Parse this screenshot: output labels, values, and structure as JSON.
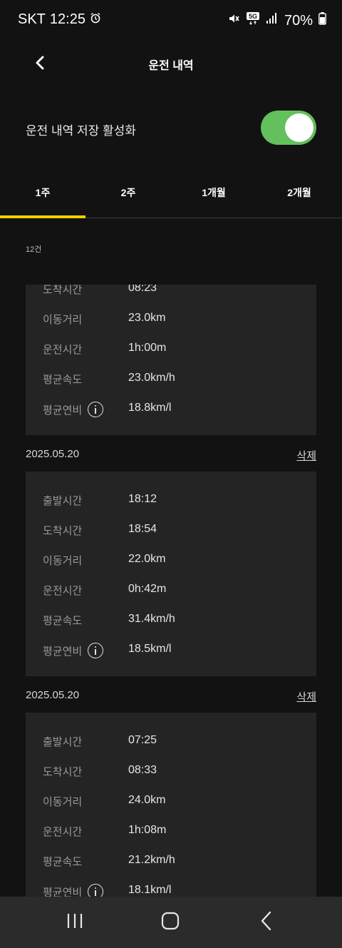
{
  "status_bar": {
    "carrier": "SKT",
    "time": "12:25",
    "battery": "70%",
    "network": "5G",
    "icons": [
      "alarm-icon",
      "mute-icon",
      "5g-icon",
      "signal-icon",
      "battery-icon"
    ]
  },
  "header": {
    "title": "운전 내역",
    "back_icon": "chevron-left-icon"
  },
  "settings": {
    "save_history_label": "운전 내역 저장 활성화",
    "save_history_enabled": true,
    "toggle_color": "#63c05c"
  },
  "tabs": {
    "items": [
      "1주",
      "2주",
      "1개월",
      "2개월"
    ],
    "selected": "1주",
    "indicator_color": "#f3d000"
  },
  "list": {
    "count_label": "12건",
    "labels": {
      "departure": "출발시간",
      "arrival": "도착시간",
      "distance": "이동거리",
      "driving_time": "운전시간",
      "avg_speed": "평균속도",
      "avg_fuel": "평균연비"
    },
    "delete_label": "삭제",
    "records": [
      {
        "date": "",
        "arrival": "08:23",
        "distance": "23.0km",
        "driving_time": "1h:00m",
        "avg_speed": "23.0km/h",
        "avg_fuel": "18.8km/l"
      },
      {
        "date": "2025.05.20",
        "departure": "18:12",
        "arrival": "18:54",
        "distance": "22.0km",
        "driving_time": "0h:42m",
        "avg_speed": "31.4km/h",
        "avg_fuel": "18.5km/l"
      },
      {
        "date": "2025.05.20",
        "departure": "07:25",
        "arrival": "08:33",
        "distance": "24.0km",
        "driving_time": "1h:08m",
        "avg_speed": "21.2km/h",
        "avg_fuel": "18.1km/l"
      }
    ]
  },
  "nav_bar": {
    "items": [
      "recent-apps-icon",
      "home-icon",
      "back-icon"
    ]
  }
}
